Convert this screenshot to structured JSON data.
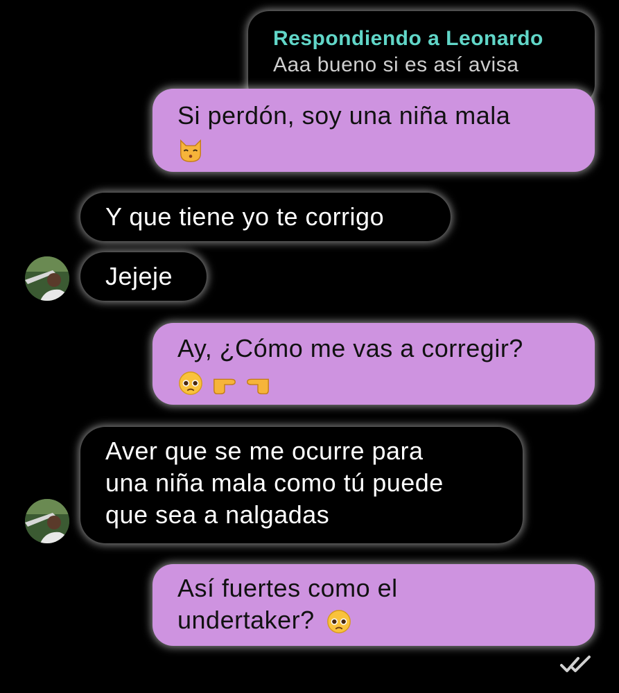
{
  "theme": {
    "outgoing_bubble": "#ce93e0",
    "incoming_bubble": "#000000",
    "reply_name_color": "#61d6c8",
    "background": "#000000"
  },
  "reply_preview": {
    "label": "Respondiendo a Leonardo",
    "quoted_text": "Aaa bueno si es así avisa"
  },
  "messages": [
    {
      "direction": "outgoing",
      "text": "Si perdón, soy una niña mala",
      "emoji": "kissing-cat-emoji"
    },
    {
      "direction": "incoming",
      "text": "Y que tiene yo te corrigo"
    },
    {
      "direction": "incoming",
      "text": "Jejeje",
      "avatar": "avatar-leonardo"
    },
    {
      "direction": "outgoing",
      "text": "Ay, ¿Cómo me vas a corregir?",
      "emoji": "pleading-face-pointing-fingers-emoji"
    },
    {
      "direction": "incoming",
      "lines": [
        "Aver que se me ocurre para",
        "una niña mala como tú puede",
        "que sea a nalgadas"
      ],
      "avatar": "avatar-leonardo"
    },
    {
      "direction": "outgoing",
      "lines": [
        "Así fuertes como el",
        "undertaker?"
      ],
      "emoji": "pleading-face-emoji"
    }
  ],
  "status_icon": "double-check-read-icon"
}
